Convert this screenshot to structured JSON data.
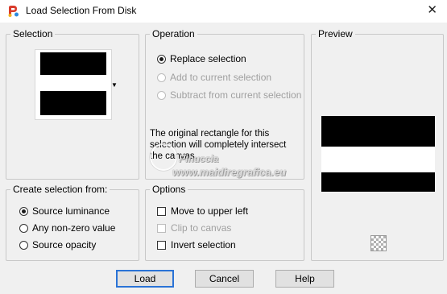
{
  "window": {
    "title": "Load Selection From Disk",
    "close_glyph": "✕",
    "app_icon": "paintshop-pro-icon"
  },
  "selection": {
    "label": "Selection",
    "dropdown_icon": "dropdown-arrow-icon"
  },
  "operation": {
    "label": "Operation",
    "options": [
      {
        "label": "Replace selection",
        "checked": true,
        "enabled": true
      },
      {
        "label": "Add to current selection",
        "checked": false,
        "enabled": false
      },
      {
        "label": "Subtract from current selection",
        "checked": false,
        "enabled": false
      }
    ],
    "info": "The original rectangle for this selection will completely intersect the canvas."
  },
  "preview": {
    "label": "Preview",
    "transparency_icon": "checkerboard-icon"
  },
  "create_from": {
    "label": "Create selection from:",
    "options": [
      {
        "label": "Source luminance",
        "checked": true
      },
      {
        "label": "Any non-zero value",
        "checked": false
      },
      {
        "label": "Source opacity",
        "checked": false
      }
    ]
  },
  "options": {
    "label": "Options",
    "items": [
      {
        "label": "Move to upper left",
        "checked": false,
        "enabled": true
      },
      {
        "label": "Clip to canvas",
        "checked": false,
        "enabled": false
      },
      {
        "label": "Invert selection",
        "checked": false,
        "enabled": true
      }
    ]
  },
  "buttons": {
    "load": "Load",
    "cancel": "Cancel",
    "help": "Help"
  },
  "watermark": {
    "name": "Pinuccia",
    "site": "www.maidiregrafica.eu"
  },
  "colors": {
    "accent": "#2a73d6",
    "background": "#f0f0f0"
  }
}
